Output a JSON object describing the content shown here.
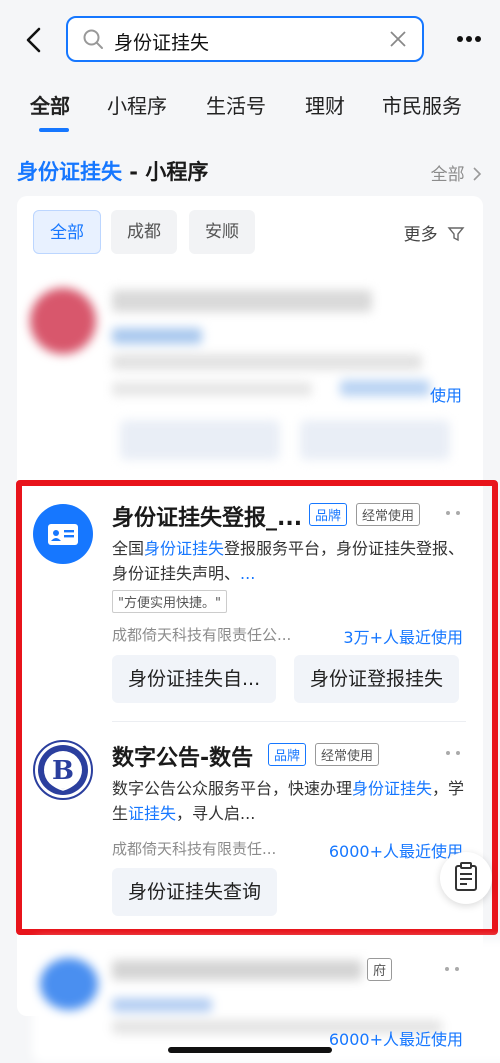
{
  "search": {
    "query": "身份证挂失"
  },
  "tabs": [
    {
      "label": "全部",
      "active": true
    },
    {
      "label": "小程序"
    },
    {
      "label": "生活号"
    },
    {
      "label": "理财"
    },
    {
      "label": "市民服务"
    }
  ],
  "section": {
    "title_highlight": "身份证挂失",
    "title_rest": " - 小程序",
    "more_label": "全部"
  },
  "filters": {
    "chips": [
      "全部",
      "成都",
      "安顺"
    ],
    "more_label": "更多"
  },
  "blurred_item": {
    "action_suffix": "使用"
  },
  "results": [
    {
      "name": "身份证挂失登报_...",
      "badge_brand": "品牌",
      "badge_often": "经常使用",
      "desc_1": "全国",
      "desc_hl_1": "身份证挂失",
      "desc_2": "登报服务平台，身份证挂失登报、身份证挂失声明、",
      "desc_more": "...",
      "tag": "\"方便实用快捷。\"",
      "company": "成都倚天科技有限责任公...",
      "usage": "3万+人最近使用",
      "actions": [
        "身份证挂失自...",
        "身份证登报挂失"
      ]
    },
    {
      "name": "数字公告-数告",
      "badge_brand": "品牌",
      "badge_often": "经常使用",
      "desc_1": "数字公告公众服务平台，快速办理",
      "desc_hl_1": "身份证挂失",
      "desc_2": "，学生",
      "desc_hl_2": "证挂失",
      "desc_3": "，寻人启...",
      "company": "成都倚天科技有限责任...",
      "usage": "6000+人最近使用",
      "actions": [
        "身份证挂失查询"
      ]
    }
  ],
  "bottom_item": {
    "badge_partial": "府",
    "usage": "6000+人最近使用"
  },
  "colors": {
    "accent": "#1677ff",
    "highlight_border": "#e8141b"
  }
}
